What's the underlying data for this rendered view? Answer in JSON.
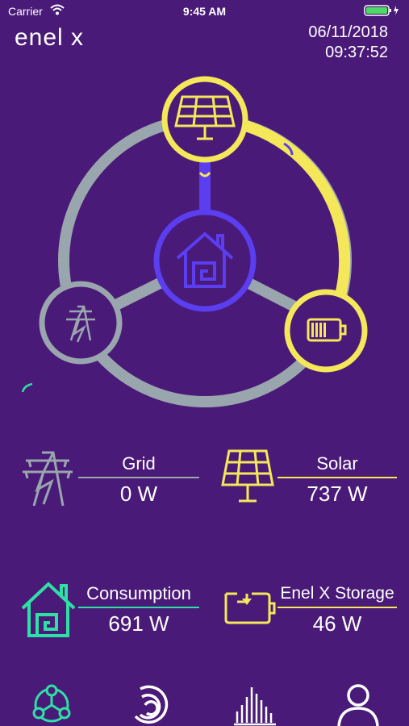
{
  "status_bar": {
    "carrier": "Carrier",
    "time": "9:45 AM"
  },
  "header": {
    "logo": "enel x",
    "date": "06/11/2018",
    "time": "09:37:52"
  },
  "stats": {
    "grid": {
      "label": "Grid",
      "value": "0 W"
    },
    "solar": {
      "label": "Solar",
      "value": "737 W"
    },
    "consumption": {
      "label": "Consumption",
      "value": "691 W"
    },
    "storage": {
      "label": "Enel X Storage",
      "value": "46 W"
    }
  },
  "colors": {
    "background": "#4a1a78",
    "grid": "#9aa6ad",
    "solar": "#f4e85a",
    "home": "#5a3ef0",
    "consumption": "#2fe0a6",
    "white": "#ffffff"
  },
  "icons": {
    "nav": [
      "network-icon",
      "gauge-icon",
      "bars-chart-icon",
      "user-icon"
    ]
  }
}
